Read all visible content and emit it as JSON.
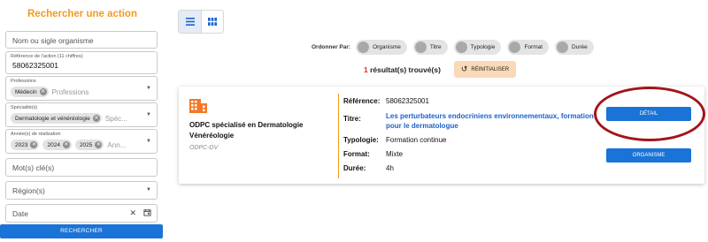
{
  "sidebar": {
    "title": "Rechercher une action",
    "org_placeholder": "Nom ou sigle organisme",
    "reference": {
      "label": "Référence de l'action (11 chiffres)",
      "value": "58062325001"
    },
    "professions": {
      "label": "Professions",
      "chip": "Médecin",
      "placeholder": "Professions"
    },
    "specialites": {
      "label": "Spécialité(s)",
      "chip": "Dermatologie et vénéréologie",
      "placeholder": "Spéc..."
    },
    "annees": {
      "label": "Année(s) de réalisation",
      "chips": [
        "2023",
        "2024",
        "2025"
      ],
      "placeholder": "Ann..."
    },
    "keywords_placeholder": "Mot(s) clé(s)",
    "region_placeholder": "Région(s)",
    "date_placeholder": "Date",
    "search_label": "RECHERCHER"
  },
  "sort": {
    "label": "Ordonner Par:",
    "options": [
      "Organisme",
      "Titre",
      "Typologie",
      "Format",
      "Durée"
    ]
  },
  "results": {
    "count": "1",
    "text": " résultat(s) trouvé(s)"
  },
  "reset_label": "RÉINITIALISER",
  "card": {
    "org_name": "ODPC spécialisé en Dermatologie Vénéréologie",
    "org_code": "ODPC-DV",
    "reference_key": "Référence:",
    "reference_value": "58062325001",
    "titre_key": "Titre:",
    "titre_value": "Les perturbateurs endocriniens environnementaux, formation pour le dermatologue",
    "typologie_key": "Typologie:",
    "typologie_value": "Formation continue",
    "format_key": "Format:",
    "format_value": "Mixte",
    "duree_key": "Durée:",
    "duree_value": "4h",
    "detail_label": "DÉTAIL",
    "organisme_label": "ORGANISME"
  },
  "colors": {
    "accent": "#f39a1d",
    "primary": "#1a73d6",
    "highlight_ring": "#a3141a"
  }
}
